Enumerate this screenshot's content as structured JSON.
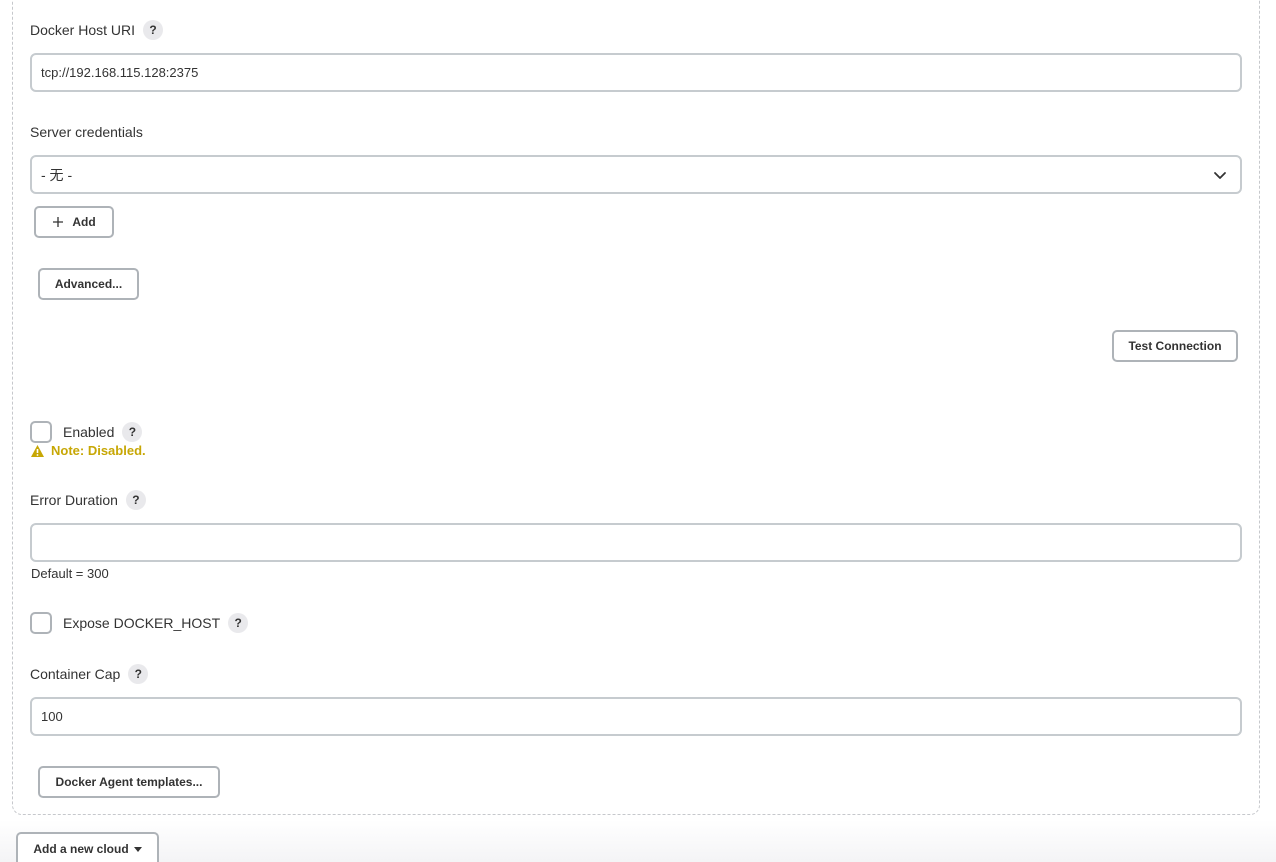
{
  "docker_host_uri": {
    "label": "Docker Host URI",
    "value": "tcp://192.168.115.128:2375"
  },
  "server_credentials": {
    "label": "Server credentials",
    "selected": "- 无 -",
    "add_label": "Add"
  },
  "advanced_label": "Advanced...",
  "test_connection_label": "Test Connection",
  "enabled": {
    "label": "Enabled",
    "checked": false,
    "note": "Note: Disabled."
  },
  "error_duration": {
    "label": "Error Duration",
    "value": "",
    "hint": "Default = 300"
  },
  "expose_docker_host": {
    "label": "Expose DOCKER_HOST",
    "checked": false
  },
  "container_cap": {
    "label": "Container Cap",
    "value": "100"
  },
  "docker_agent_templates_label": "Docker Agent templates...",
  "add_new_cloud_label": "Add a new cloud",
  "help_glyph": "?",
  "colors": {
    "warning": "#c7a705",
    "border": "#c6cbcf",
    "help_bg": "#e9e9ec"
  }
}
